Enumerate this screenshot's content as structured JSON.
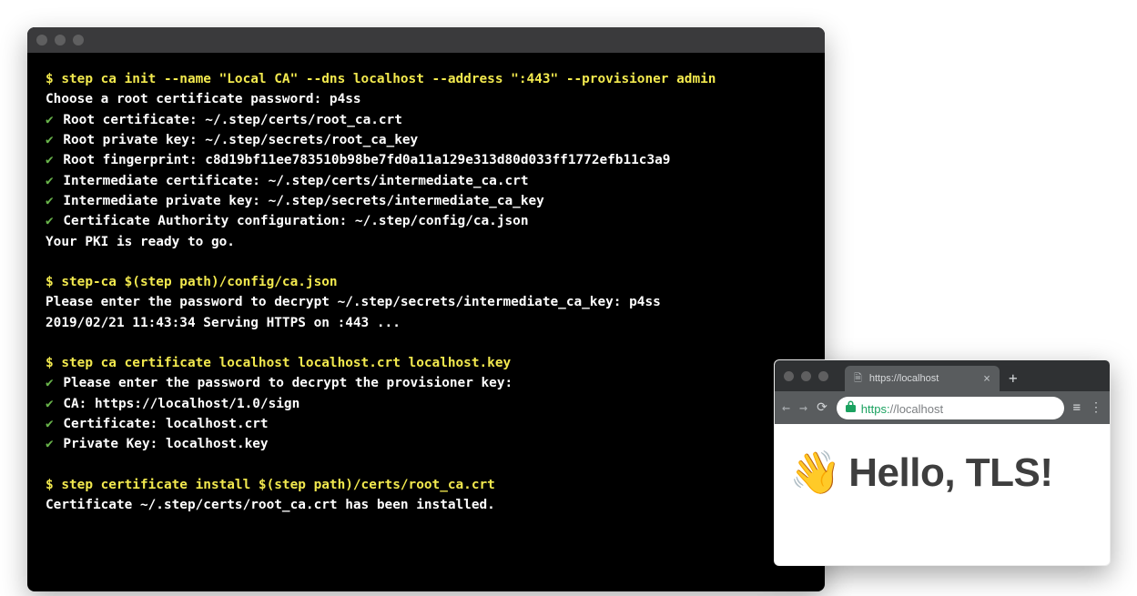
{
  "terminal": {
    "prompt": "$",
    "lines": [
      {
        "type": "cmd",
        "text": "step ca init --name \"Local CA\" --dns localhost --address \":443\" --provisioner admin"
      },
      {
        "type": "out",
        "text": "Choose a root certificate password: p4ss"
      },
      {
        "type": "chk",
        "text": "Root certificate: ~/.step/certs/root_ca.crt"
      },
      {
        "type": "chk",
        "text": "Root private key: ~/.step/secrets/root_ca_key"
      },
      {
        "type": "chk",
        "text": "Root fingerprint: c8d19bf11ee783510b98be7fd0a11a129e313d80d033ff1772efb11c3a9"
      },
      {
        "type": "chk",
        "text": "Intermediate certificate: ~/.step/certs/intermediate_ca.crt"
      },
      {
        "type": "chk",
        "text": "Intermediate private key: ~/.step/secrets/intermediate_ca_key"
      },
      {
        "type": "chk",
        "text": "Certificate Authority configuration: ~/.step/config/ca.json"
      },
      {
        "type": "out",
        "text": "Your PKI is ready to go."
      },
      {
        "type": "blank"
      },
      {
        "type": "cmd",
        "text": "step-ca $(step path)/config/ca.json"
      },
      {
        "type": "out",
        "text": "Please enter the password to decrypt ~/.step/secrets/intermediate_ca_key: p4ss"
      },
      {
        "type": "out",
        "text": "2019/02/21 11:43:34 Serving HTTPS on :443 ..."
      },
      {
        "type": "blank"
      },
      {
        "type": "cmd",
        "text": "step ca certificate localhost localhost.crt localhost.key"
      },
      {
        "type": "chk",
        "text": "Please enter the password to decrypt the provisioner key:"
      },
      {
        "type": "chk",
        "text": "CA: https://localhost/1.0/sign"
      },
      {
        "type": "chk",
        "text": "Certificate: localhost.crt"
      },
      {
        "type": "chk",
        "text": "Private Key: localhost.key"
      },
      {
        "type": "blank"
      },
      {
        "type": "cmd",
        "text": "step certificate install $(step path)/certs/root_ca.crt"
      },
      {
        "type": "out",
        "text": "Certificate ~/.step/certs/root_ca.crt has been installed."
      }
    ],
    "check_glyph": "✔"
  },
  "browser": {
    "tab_title": "https://localhost",
    "url_protocol": "https:",
    "url_rest": "//localhost",
    "content_emoji": "👋",
    "content_text": "Hello, TLS!",
    "glyphs": {
      "back": "←",
      "forward": "→",
      "reload": "⟳",
      "close": "×",
      "plus": "+",
      "lock": "🔒",
      "file": "🗎",
      "ext": "≡",
      "menu": "⋮"
    }
  }
}
